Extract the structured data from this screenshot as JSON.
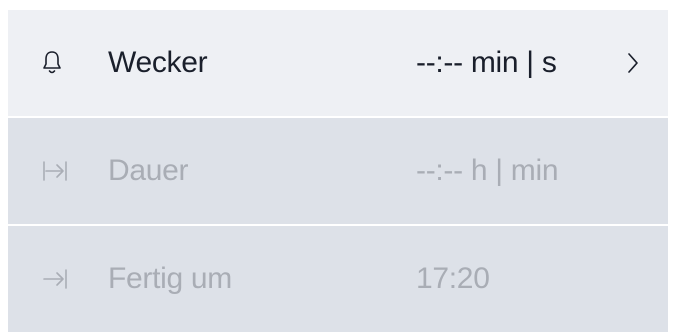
{
  "rows": [
    {
      "icon": "bell-icon",
      "label": "Wecker",
      "value": "--:--  min | s",
      "active": true,
      "chevron": "chevron-right-icon"
    },
    {
      "icon": "duration-icon",
      "label": "Dauer",
      "value": "--:--  h | min",
      "active": false
    },
    {
      "icon": "finish-time-icon",
      "label": "Fertig um",
      "value": "17:20",
      "active": false
    }
  ]
}
